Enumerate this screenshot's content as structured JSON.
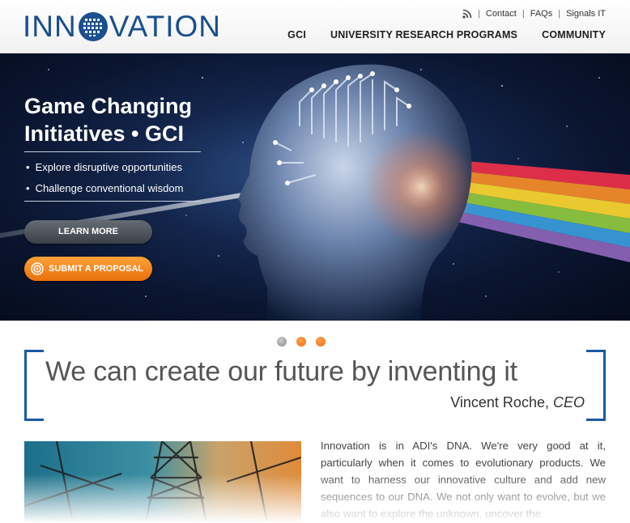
{
  "header": {
    "logo_text_left": "INN",
    "logo_text_right": "VATION",
    "utility_links": [
      "Contact",
      "FAQs",
      "Signals IT"
    ],
    "nav": [
      "GCI",
      "UNIVERSITY RESEARCH PROGRAMS",
      "COMMUNITY"
    ]
  },
  "hero": {
    "title_line1": "Game Changing",
    "title_line2": "Initiatives • GCI",
    "bullets": [
      "Explore disruptive opportunities",
      "Challenge conventional wisdom"
    ],
    "learn_more": "LEARN MORE",
    "submit": "SUBMIT A PROPOSAL"
  },
  "carousel": {
    "slides": 3,
    "active": 0
  },
  "quote": {
    "text": "We can create our future by inventing it",
    "author": "Vincent Roche,",
    "role": "CEO"
  },
  "intro_text": "Innovation is in ADI's DNA. We're very good at it, particularly when it comes to evolutionary products. We want to harness our innovative culture and add new sequences to our DNA. We not only want to evolve, but we also want to explore the unknown, uncover the",
  "colors": {
    "brand_blue": "#1b4f8e",
    "accent_orange": "#f28a1e",
    "bracket_blue": "#1b5aa3"
  }
}
